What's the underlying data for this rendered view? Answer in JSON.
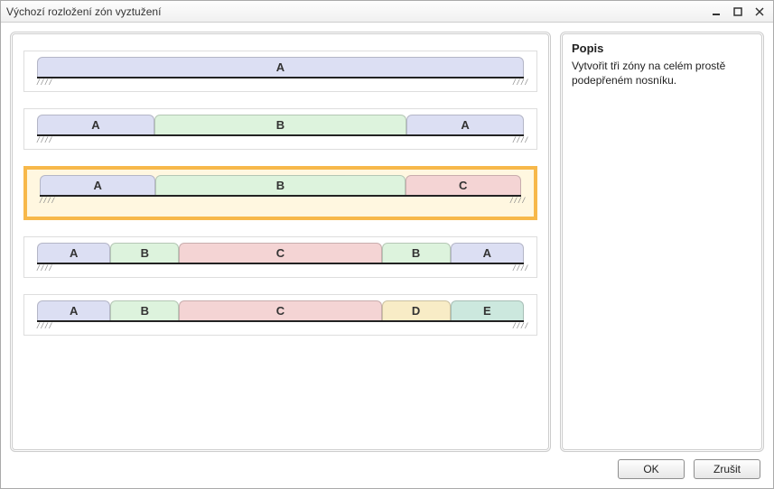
{
  "window": {
    "title": "Výchozí rozložení zón vyztužení"
  },
  "description": {
    "heading": "Popis",
    "text": "Vytvořit tři zóny na celém prostě podepřeném nosníku."
  },
  "buttons": {
    "ok": "OK",
    "cancel": "Zrušit"
  },
  "layouts": [
    {
      "selected": false,
      "zones": [
        {
          "label": "A",
          "color": "purple",
          "flex": 1
        }
      ]
    },
    {
      "selected": false,
      "zones": [
        {
          "label": "A",
          "color": "purple",
          "flex": 0.24
        },
        {
          "label": "B",
          "color": "green",
          "flex": 0.52
        },
        {
          "label": "A",
          "color": "purple",
          "flex": 0.24
        }
      ]
    },
    {
      "selected": true,
      "zones": [
        {
          "label": "A",
          "color": "purple",
          "flex": 0.24
        },
        {
          "label": "B",
          "color": "green",
          "flex": 0.52
        },
        {
          "label": "C",
          "color": "pink",
          "flex": 0.24
        }
      ]
    },
    {
      "selected": false,
      "zones": [
        {
          "label": "A",
          "color": "purple",
          "flex": 0.15
        },
        {
          "label": "B",
          "color": "green",
          "flex": 0.14
        },
        {
          "label": "C",
          "color": "pink",
          "flex": 0.42
        },
        {
          "label": "B",
          "color": "green",
          "flex": 0.14
        },
        {
          "label": "A",
          "color": "purple",
          "flex": 0.15
        }
      ]
    },
    {
      "selected": false,
      "zones": [
        {
          "label": "A",
          "color": "purple",
          "flex": 0.15
        },
        {
          "label": "B",
          "color": "green",
          "flex": 0.14
        },
        {
          "label": "C",
          "color": "pink",
          "flex": 0.42
        },
        {
          "label": "D",
          "color": "yellow",
          "flex": 0.14
        },
        {
          "label": "E",
          "color": "teal",
          "flex": 0.15
        }
      ]
    }
  ]
}
